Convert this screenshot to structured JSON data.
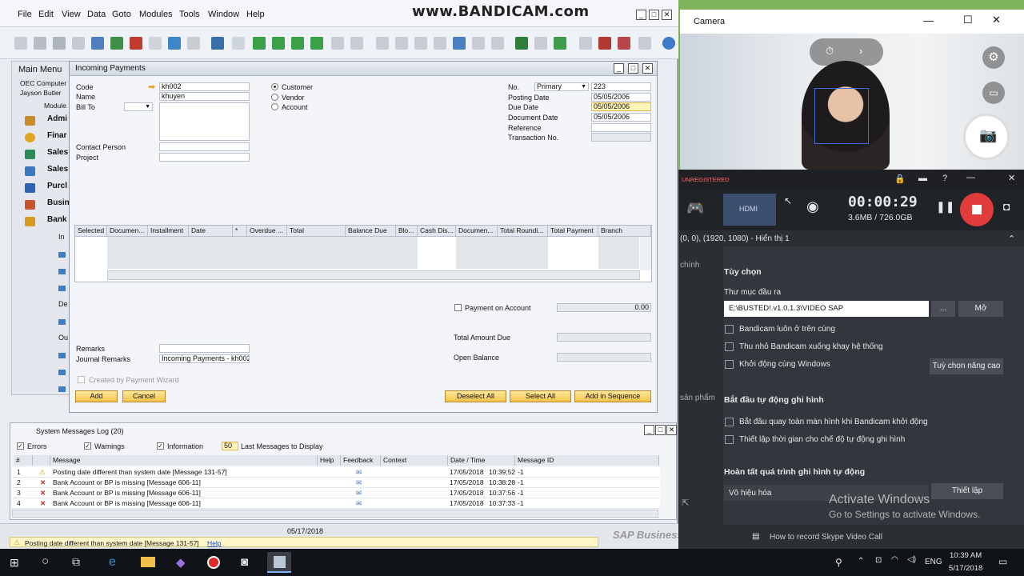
{
  "sap": {
    "menu": [
      "File",
      "Edit",
      "View",
      "Data",
      "Goto",
      "Modules",
      "Tools",
      "Window",
      "Help"
    ],
    "watermark": "www.BANDICAM.com",
    "main_menu": {
      "title": "Main Menu",
      "company": "OEC Computer",
      "user": "Jayson Butler",
      "tab": "Module",
      "items": [
        "Admi",
        "Finar",
        "Sales",
        "Sales",
        "Purcl",
        "Busin",
        "Bank"
      ],
      "sub_items": [
        "In",
        "De",
        "Ou"
      ]
    },
    "payments": {
      "title": "Incoming Payments",
      "code_label": "Code",
      "code_value": "kh002",
      "name_label": "Name",
      "name_value": "khuyen",
      "billto_label": "Bill To",
      "contact_label": "Contact Person",
      "project_label": "Project",
      "radio": [
        "Customer",
        "Vendor",
        "Account"
      ],
      "no_label": "No.",
      "no_series": "Primary",
      "no_value": "223",
      "posting_label": "Posting Date",
      "posting_value": "05/05/2006",
      "due_label": "Due Date",
      "due_value": "05/05/2006",
      "docdate_label": "Document Date",
      "docdate_value": "05/05/2006",
      "reference_label": "Reference",
      "transaction_label": "Transaction No.",
      "grid_headers": [
        "Selected",
        "Documen...",
        "Installment",
        "Date",
        "*",
        "Overdue ...",
        "Total",
        "Balance Due",
        "Blo...",
        "Cash Dis...",
        "Documen...",
        "Total Roundi...",
        "Total Payment",
        "Branch"
      ],
      "payment_on_account_label": "Payment on Account",
      "payment_on_account_value": "0.00",
      "total_amount_due_label": "Total Amount Due",
      "open_balance_label": "Open Balance",
      "remarks_label": "Remarks",
      "journal_label": "Journal Remarks",
      "journal_value": "Incoming Payments - kh002",
      "wizard_label": "Created by Payment Wizard",
      "buttons": {
        "add": "Add",
        "cancel": "Cancel",
        "deselect": "Deselect All",
        "select": "Select All",
        "sequence": "Add in Sequence"
      }
    },
    "messages": {
      "title": "System Messages Log (20)",
      "errors": "Errors",
      "warnings": "Warnings",
      "information": "Information",
      "count": "50",
      "count_label": "Last Messages to Display",
      "headers": [
        "#",
        "",
        "Message",
        "Help",
        "Feedback",
        "Context",
        "Date / Time",
        "Message ID"
      ],
      "rows": [
        {
          "n": "1",
          "type": "warning",
          "msg": "Posting date different than system date  [Message 131-57]",
          "date": "17/05/2018",
          "time": "10:39:52",
          "id": "-1"
        },
        {
          "n": "2",
          "type": "error",
          "msg": "Bank Account or BP is missing  [Message 606-11]",
          "date": "17/05/2018",
          "time": "10:38:28",
          "id": "-1"
        },
        {
          "n": "3",
          "type": "error",
          "msg": "Bank Account or BP is missing  [Message 606-11]",
          "date": "17/05/2018",
          "time": "10:37:56",
          "id": "-1"
        },
        {
          "n": "4",
          "type": "error",
          "msg": "Bank Account or BP is missing  [Message 606-11]",
          "date": "17/05/2018",
          "time": "10:37:33",
          "id": "-1"
        }
      ]
    },
    "status": {
      "date": "05/17/2018",
      "message": "Posting date different than system date  [Message 131-57]",
      "help": "Help",
      "brand": "SAP Business One"
    }
  },
  "camera": {
    "title": "Camera"
  },
  "bandicam": {
    "unregistered": "UNREGISTERED",
    "timer": "00:00:29",
    "size": "3.6MB / 726.0GB",
    "region": "(0, 0), (1920, 1080) - Hiển thị 1",
    "side_label_1": "chính",
    "side_label_2": "sản phẩm",
    "options_title": "Tùy chọn",
    "output_label": "Thư mục đầu ra",
    "output_path": "E:\\BUSTED!.v1.0.1.3\\VIDEO SAP",
    "browse": "...",
    "open": "Mở",
    "opt1": "Bandicam luôn ở trên cùng",
    "opt2": "Thu nhỏ Bandicam xuống khay hệ thống",
    "opt3": "Khởi động cùng Windows",
    "advanced": "Tuỳ chọn nâng cao",
    "autostart_title": "Bắt đầu tự động ghi hình",
    "auto1": "Bắt đầu quay toàn màn hình khi Bandicam khởi động",
    "auto2": "Thiết lập thời gian cho chế độ tự động ghi hình",
    "finish_title": "Hoàn tất quá trình ghi hình tự động",
    "finish_value": "Vô hiệu hóa",
    "setup": "Thiết lập",
    "skype": "How to record Skype Video Call"
  },
  "activate": {
    "title": "Activate Windows",
    "sub": "Go to Settings to activate Windows."
  },
  "taskbar": {
    "lang": "ENG",
    "time": "10:39 AM",
    "date": "5/17/2018"
  }
}
